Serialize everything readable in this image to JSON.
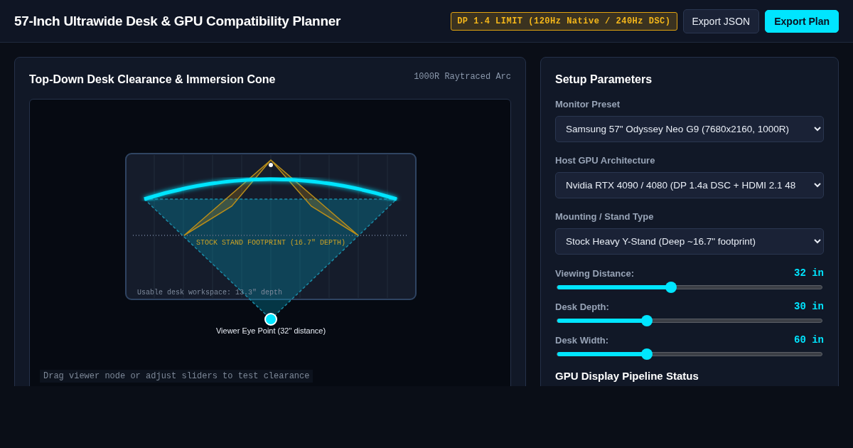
{
  "header": {
    "title": "57-Inch Ultrawide Desk & GPU Compatibility Planner",
    "limit_badge": "DP 1.4 LIMIT (120Hz Native / 240Hz DSC)",
    "buttons": [
      {
        "label": "Export JSON",
        "kind": "secondary"
      },
      {
        "label": "Export Plan",
        "kind": "primary"
      }
    ]
  },
  "diagram_panel": {
    "title": "Top-Down Desk Clearance & Immersion Cone",
    "subtitle": "1000R Raytraced Arc",
    "footprint_label": "STOCK STAND FOOTPRINT (16.7\" DEPTH)",
    "workspace_label": "Usable desk workspace: 13.3\" depth",
    "eye_label": "Viewer Eye Point (32\" distance)",
    "hint": "Drag viewer node or adjust sliders to test clearance"
  },
  "parameters_panel": {
    "title": "Setup Parameters",
    "selects": [
      {
        "label": "Monitor Preset",
        "value": "Samsung 57\" Odyssey Neo G9 (7680x2160, 1000R)"
      },
      {
        "label": "Host GPU Architecture",
        "value": "Nvidia RTX 4090 / 4080 (DP 1.4a DSC + HDMI 2.1 48"
      },
      {
        "label": "Mounting / Stand Type",
        "value": "Stock Heavy Y-Stand (Deep ~16.7\" footprint)"
      }
    ],
    "sliders": [
      {
        "label": "Viewing Distance:",
        "reading": "32 in",
        "level": 0.43
      },
      {
        "label": "Desk Depth:",
        "reading": "30 in",
        "level": 0.34
      },
      {
        "label": "Desk Width:",
        "reading": "60 in",
        "level": 0.34
      }
    ],
    "section_title": "GPU Display Pipeline Status"
  }
}
